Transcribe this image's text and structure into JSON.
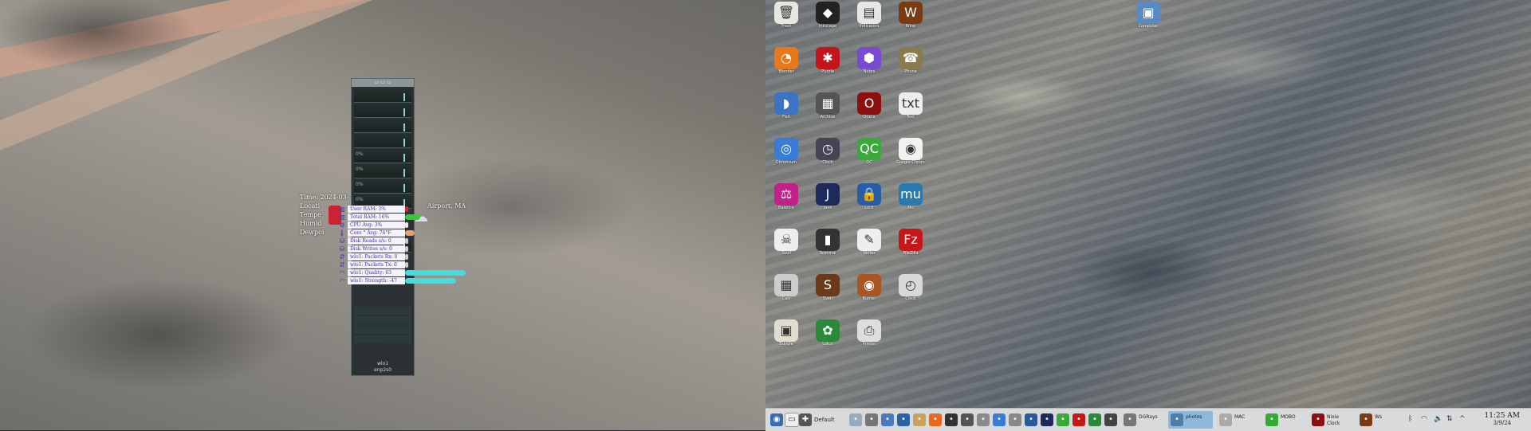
{
  "weather": {
    "lines": [
      "Time: 2024-03-",
      "Locati",
      "Tempe",
      "Humid",
      "Dewpoi"
    ],
    "location_suffix": "Airport, MA"
  },
  "conky": {
    "graph_labels": [
      "0%",
      "0%",
      "0%",
      "0%"
    ],
    "footer_top": "wlo1",
    "footer_bottom": "enp2s0"
  },
  "stats": [
    {
      "label": "User RAM: 3%",
      "icon": "memory-icon",
      "bar_color": "#dd2222",
      "percent": 3
    },
    {
      "label": "Total RAM: 16%",
      "icon": "memory-icon",
      "bar_color": "#33cc33",
      "percent": 16
    },
    {
      "label": "CPU Avg: 3%",
      "icon": "cpu-icon",
      "bar_color": "#eeeeee",
      "percent": 3
    },
    {
      "label": "Core ° Avg: 76°F",
      "icon": "thermometer-icon",
      "bar_color": "#e8a070",
      "percent": 10
    },
    {
      "label": "Disk Reads s/s: 0",
      "icon": "disk-icon",
      "bar_color": "#cccccc",
      "percent": 0
    },
    {
      "label": "Disk Writes s/s: 0",
      "icon": "disk-icon",
      "bar_color": "#cccccc",
      "percent": 0
    },
    {
      "label": "wlo1: Packets Rx: 0",
      "icon": "network-icon",
      "bar_color": "#cccccc",
      "percent": 0
    },
    {
      "label": "wlo1: Packets Tx: 0",
      "icon": "network-icon",
      "bar_color": "#cccccc",
      "percent": 0
    },
    {
      "label": "wlo1: Quality: 63",
      "icon": "wifi-icon",
      "bar_color": "#44dddd",
      "percent": 63
    },
    {
      "label": "wlo1: Strength: -47",
      "icon": "wifi-icon",
      "bar_color": "#44dddd",
      "percent": 53
    }
  ],
  "desktop_icons": [
    {
      "label": "Trash",
      "icon": "trash-icon",
      "color": "#e8e6e0"
    },
    {
      "label": "Inkscape",
      "icon": "inkscape-icon",
      "color": "#222"
    },
    {
      "label": "Indicators",
      "icon": "indicator-icon",
      "color": "#e6e6e6"
    },
    {
      "label": "Wine",
      "icon": "wine-icon",
      "color": "#7a3a12"
    },
    {
      "label": "Blender",
      "icon": "blender-icon",
      "color": "#e8781c"
    },
    {
      "label": "Puzzle",
      "icon": "puzzle-icon",
      "color": "#c3161c"
    },
    {
      "label": "Notes",
      "icon": "cube-icon",
      "color": "#7a4ad0"
    },
    {
      "label": "Phone",
      "icon": "phone-icon",
      "color": "#8a7a50"
    },
    {
      "label": "Fish",
      "icon": "fish-icon",
      "color": "#3b74c2"
    },
    {
      "label": "Archive",
      "icon": "archive-icon",
      "color": "#555"
    },
    {
      "label": "Opera",
      "icon": "opera-icon",
      "color": "#8c1010"
    },
    {
      "label": "Text",
      "icon": "text-file-icon",
      "color": "#eee"
    },
    {
      "label": "Chromium",
      "icon": "chromium-icon",
      "color": "#3a7bd5"
    },
    {
      "label": "Clock",
      "icon": "timer-icon",
      "color": "#445"
    },
    {
      "label": "QC",
      "icon": "qc-icon",
      "color": "#3aa83a"
    },
    {
      "label": "Google Chrome",
      "icon": "chrome-icon",
      "color": "#f2f2f2"
    },
    {
      "label": "Balance",
      "icon": "scales-icon",
      "color": "#c2208a"
    },
    {
      "label": "Jave",
      "icon": "j-icon",
      "color": "#1e2a5a"
    },
    {
      "label": "Lock",
      "icon": "lock-icon",
      "color": "#2a5da8"
    },
    {
      "label": "Mu",
      "icon": "mu-icon",
      "color": "#2a7ab0"
    },
    {
      "label": "Skull",
      "icon": "skull-icon",
      "color": "#eee"
    },
    {
      "label": "Terminal",
      "icon": "terminal-icon",
      "color": "#333"
    },
    {
      "label": "Writer",
      "icon": "pen-icon",
      "color": "#eee"
    },
    {
      "label": "FileZilla",
      "icon": "filezilla-icon",
      "color": "#c41818"
    },
    {
      "label": "Calc",
      "icon": "calculator-icon",
      "color": "#ccc"
    },
    {
      "label": "Sven",
      "icon": "game-icon",
      "color": "#6a3a1a"
    },
    {
      "label": "Burner",
      "icon": "disc-icon",
      "color": "#aa5522"
    },
    {
      "label": "Clock",
      "icon": "clock-icon",
      "color": "#d8d8d8"
    },
    {
      "label": "Bundle",
      "icon": "box-icon",
      "color": "#e0dcd0"
    },
    {
      "label": "Lotus",
      "icon": "lotus-icon",
      "color": "#2a8a3a"
    },
    {
      "label": "Printer",
      "icon": "printer-icon",
      "color": "#ddd"
    }
  ],
  "right_desktop_icon": {
    "label": "Computer",
    "icon": "computer-icon",
    "color": "#5a8ac0"
  },
  "taskbar": {
    "default_label": "Default",
    "tasks": [
      {
        "name": "dgrays",
        "label": "DGRays",
        "icon": "lightbulb-icon",
        "color": "#777"
      },
      {
        "name": "photos",
        "label": "photos",
        "icon": "photos-icon",
        "color": "#4d7da8"
      },
      {
        "name": "mac",
        "label": "MAC",
        "icon": "clock-icon",
        "color": "#aaa"
      },
      {
        "name": "mobo",
        "label": "MOBO",
        "icon": "indicator-icon",
        "color": "#3a3"
      },
      {
        "name": "nixie",
        "label": "Nixie Clock",
        "icon": "nixie-icon",
        "color": "#8c1010"
      },
      {
        "name": "ws",
        "label": "Ws",
        "icon": "wine-icon",
        "color": "#7a3a12"
      }
    ],
    "clock_time": "11:25 AM",
    "clock_date": "3/9/24"
  }
}
